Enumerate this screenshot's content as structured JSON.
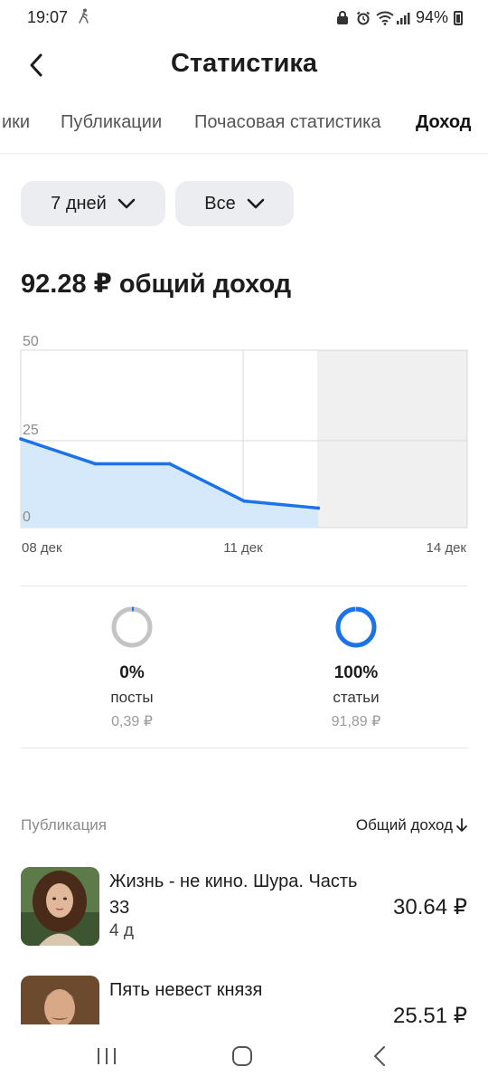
{
  "status_bar": {
    "time": "19:07",
    "battery": "94%",
    "icons": [
      "walk-icon",
      "vpn-icon",
      "alarm-icon",
      "wifi-icon",
      "signal-icon",
      "battery-icon"
    ]
  },
  "header": {
    "title": "Статистика",
    "back_icon": "chevron-left-icon"
  },
  "tabs": [
    {
      "label": "ики",
      "active": false
    },
    {
      "label": "Публикации",
      "active": false
    },
    {
      "label": "Почасовая статистика",
      "active": false
    },
    {
      "label": "Доход",
      "active": true
    }
  ],
  "filters": {
    "period": "7 дней",
    "type": "Все",
    "dropdown_icon": "chevron-down-icon"
  },
  "total_income": "92.28 ₽ общий доход",
  "chart_data": {
    "type": "area",
    "x": [
      "08 дек",
      "09 дек",
      "10 дек",
      "11 дек",
      "12 дек"
    ],
    "values": [
      25,
      18,
      18,
      7.5,
      5.5
    ],
    "x_tick_labels": [
      "08 дек",
      "11 дек",
      "14 дек"
    ],
    "y_tick_labels": [
      "50",
      "25",
      "0"
    ],
    "ylim": [
      0,
      50
    ],
    "x_range": [
      "08 дек",
      "14 дек"
    ],
    "grid": true,
    "colors": {
      "line": "#1a73e8",
      "fill": "#d6e9fb",
      "future_area": "#f0f0f0"
    }
  },
  "breakdown": [
    {
      "percent": "0%",
      "label": "посты",
      "amount": "0,39 ₽",
      "ring_fill": 0.0,
      "color": "#c4c4c4"
    },
    {
      "percent": "100%",
      "label": "статьи",
      "amount": "91,89 ₽",
      "ring_fill": 1.0,
      "color": "#1a73e8"
    }
  ],
  "list": {
    "header_left": "Публикация",
    "header_right": "Общий доход",
    "sort_icon": "arrow-down-icon",
    "items": [
      {
        "title": "Жизнь - не кино. Шура. Часть 33",
        "age": "4 д",
        "amount": "30.64 ₽"
      },
      {
        "title": "Пять невест князя",
        "age": "",
        "amount": "25.51 ₽"
      }
    ]
  },
  "nav_bar": {
    "icons": [
      "recent-apps-icon",
      "home-icon",
      "back-icon"
    ]
  }
}
